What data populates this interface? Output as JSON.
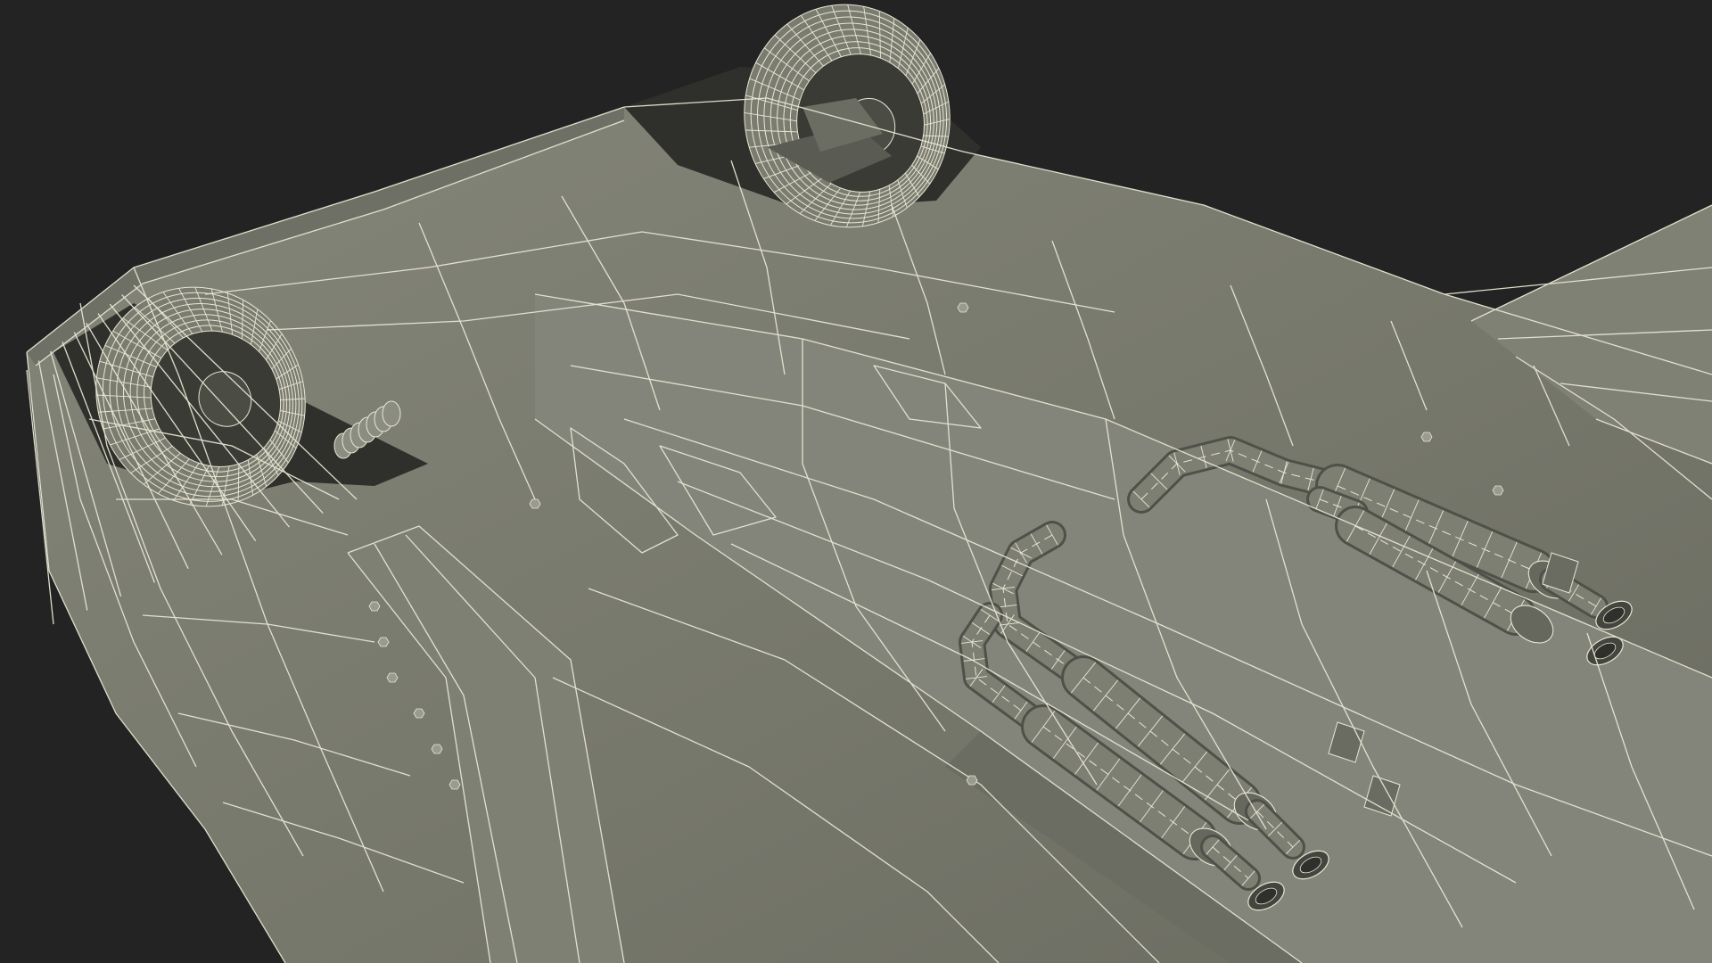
{
  "viewport": {
    "background_color": "#232323",
    "model_surface_color": "#7a7b6f",
    "model_shadow_color": "#55564c",
    "model_highlight_color": "#8e8f83",
    "wireframe_color": "#e8e6d4",
    "cavity_color": "#2f302b"
  }
}
